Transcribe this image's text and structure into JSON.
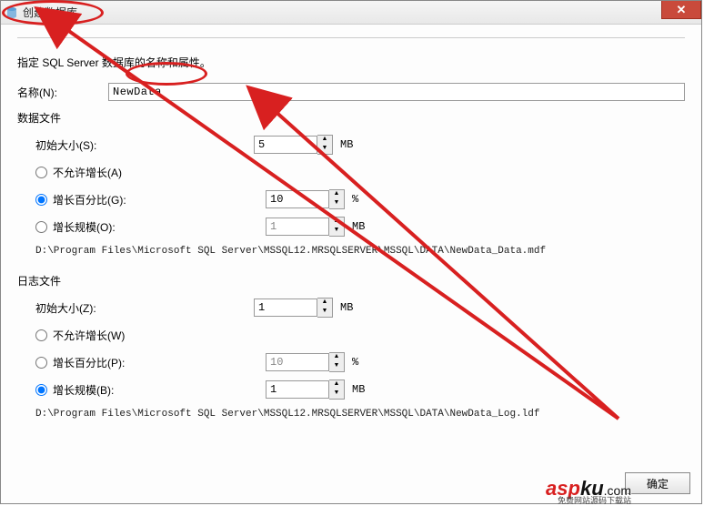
{
  "window": {
    "title": "创建数据库"
  },
  "instruction": "指定 SQL Server 数据库的名称和属性。",
  "name": {
    "label": "名称(N):",
    "value": "NewData"
  },
  "data_file": {
    "header": "数据文件",
    "initial_size": {
      "label": "初始大小(S):",
      "value": "5",
      "unit": "MB"
    },
    "no_growth": {
      "label": "不允许增长(A)"
    },
    "growth_percent": {
      "label": "增长百分比(G):",
      "value": "10",
      "unit": "%"
    },
    "growth_size": {
      "label": "增长规模(O):",
      "value": "1",
      "unit": "MB"
    },
    "path": "D:\\Program Files\\Microsoft SQL Server\\MSSQL12.MRSQLSERVER\\MSSQL\\DATA\\NewData_Data.mdf"
  },
  "log_file": {
    "header": "日志文件",
    "initial_size": {
      "label": "初始大小(Z):",
      "value": "1",
      "unit": "MB"
    },
    "no_growth": {
      "label": "不允许增长(W)"
    },
    "growth_percent": {
      "label": "增长百分比(P):",
      "value": "10",
      "unit": "%"
    },
    "growth_size": {
      "label": "增长规模(B):",
      "value": "1",
      "unit": "MB"
    },
    "path": "D:\\Program Files\\Microsoft SQL Server\\MSSQL12.MRSQLSERVER\\MSSQL\\DATA\\NewData_Log.ldf"
  },
  "footer": {
    "ok": "确定"
  },
  "watermark": {
    "brand_red": "asp",
    "brand_black": "ku",
    "suffix": ".com",
    "sub": "免费网站源码下载站"
  }
}
